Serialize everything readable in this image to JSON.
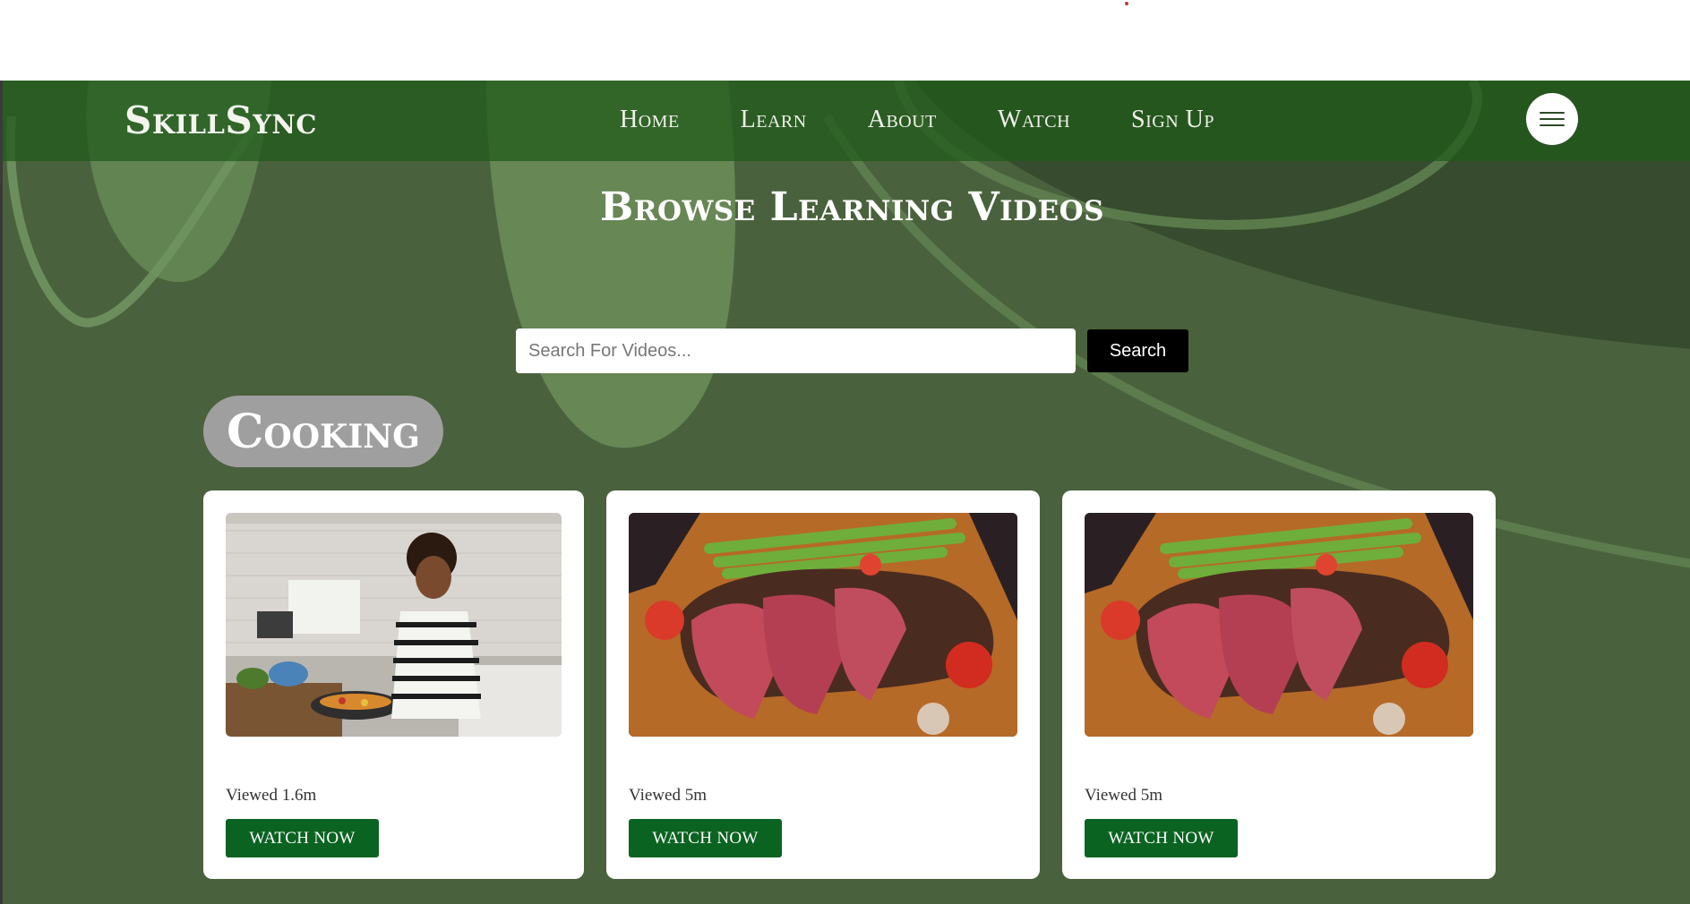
{
  "brand": "SkillSync",
  "nav": {
    "items": [
      "Home",
      "Learn",
      "About",
      "Watch",
      "Sign Up"
    ]
  },
  "page": {
    "title": "Browse Learning Videos"
  },
  "search": {
    "placeholder": "Search For Videos...",
    "value": "",
    "button_label": "Search"
  },
  "category": {
    "name": "Cooking"
  },
  "videos": [
    {
      "thumbnail": "woman-cooking-in-kitchen",
      "views": "Viewed 1.6m",
      "button_label": "WATCH NOW"
    },
    {
      "thumbnail": "sliced-steak-with-asparagus",
      "views": "Viewed 5m",
      "button_label": "WATCH NOW"
    },
    {
      "thumbnail": "sliced-steak-with-asparagus",
      "views": "Viewed 5m",
      "button_label": "WATCH NOW"
    }
  ],
  "colors": {
    "background": "#4a613d",
    "topbar": "#2f5a22",
    "button_primary": "#0b6321",
    "search_button": "#000000",
    "category_pill": "#a09fa0"
  },
  "icons": {
    "menu": "hamburger-menu-icon"
  }
}
